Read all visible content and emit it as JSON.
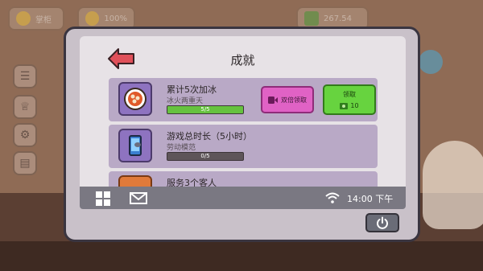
{
  "hud": {
    "level_name": "掌柜",
    "mood_percent": "100%",
    "money": "267.54"
  },
  "dialog": {
    "title": "成就",
    "achievements": [
      {
        "name": "累计5次加冰",
        "desc": "冰火两重天",
        "progress_text": "5/5",
        "progress_fraction": 1.0,
        "double_label": "双倍领取",
        "claim_label": "领取",
        "reward": "10"
      },
      {
        "name": "游戏总时长（5小时）",
        "desc": "劳动模范",
        "progress_text": "0/5",
        "progress_fraction": 0.0
      },
      {
        "name": "服务3个客人"
      }
    ]
  },
  "taskbar": {
    "time": "14:00 下午"
  },
  "colors": {
    "panel": "#e7e2e6",
    "row": "#b9a9c6",
    "claim_green": "#67d33f",
    "double_pink": "#e062c5",
    "back_arrow": "#e0505a"
  }
}
